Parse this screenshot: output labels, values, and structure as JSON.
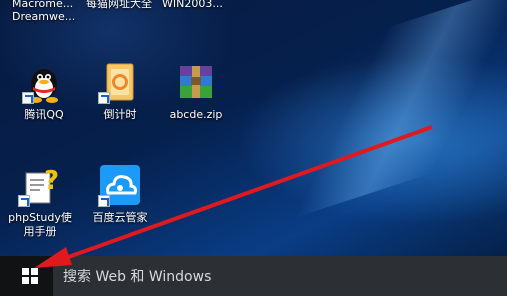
{
  "desktop": {
    "top_items": [
      {
        "line1": "Macrome...",
        "line2": "Dreamwe..."
      },
      {
        "line1": "每猫网址大全",
        "line2": ""
      },
      {
        "line1": "WIN2003...",
        "line2": ""
      }
    ],
    "icons": [
      {
        "label": "腾讯QQ",
        "icon": "qq-penguin-icon"
      },
      {
        "label": "倒计时",
        "icon": "countdown-file-icon"
      },
      {
        "label": "abcde.zip",
        "icon": "zip-archive-icon"
      },
      {
        "label_line1": "phpStudy使",
        "label_line2": "用手册",
        "icon": "help-document-icon"
      },
      {
        "label": "百度云管家",
        "icon": "baidu-cloud-icon"
      }
    ]
  },
  "taskbar": {
    "search_placeholder": "搜索 Web 和 Windows",
    "start_icon": "windows-logo-icon"
  },
  "colors": {
    "arrow": "#e0191f",
    "taskbar": "#101214",
    "search": "#2c2f33"
  }
}
